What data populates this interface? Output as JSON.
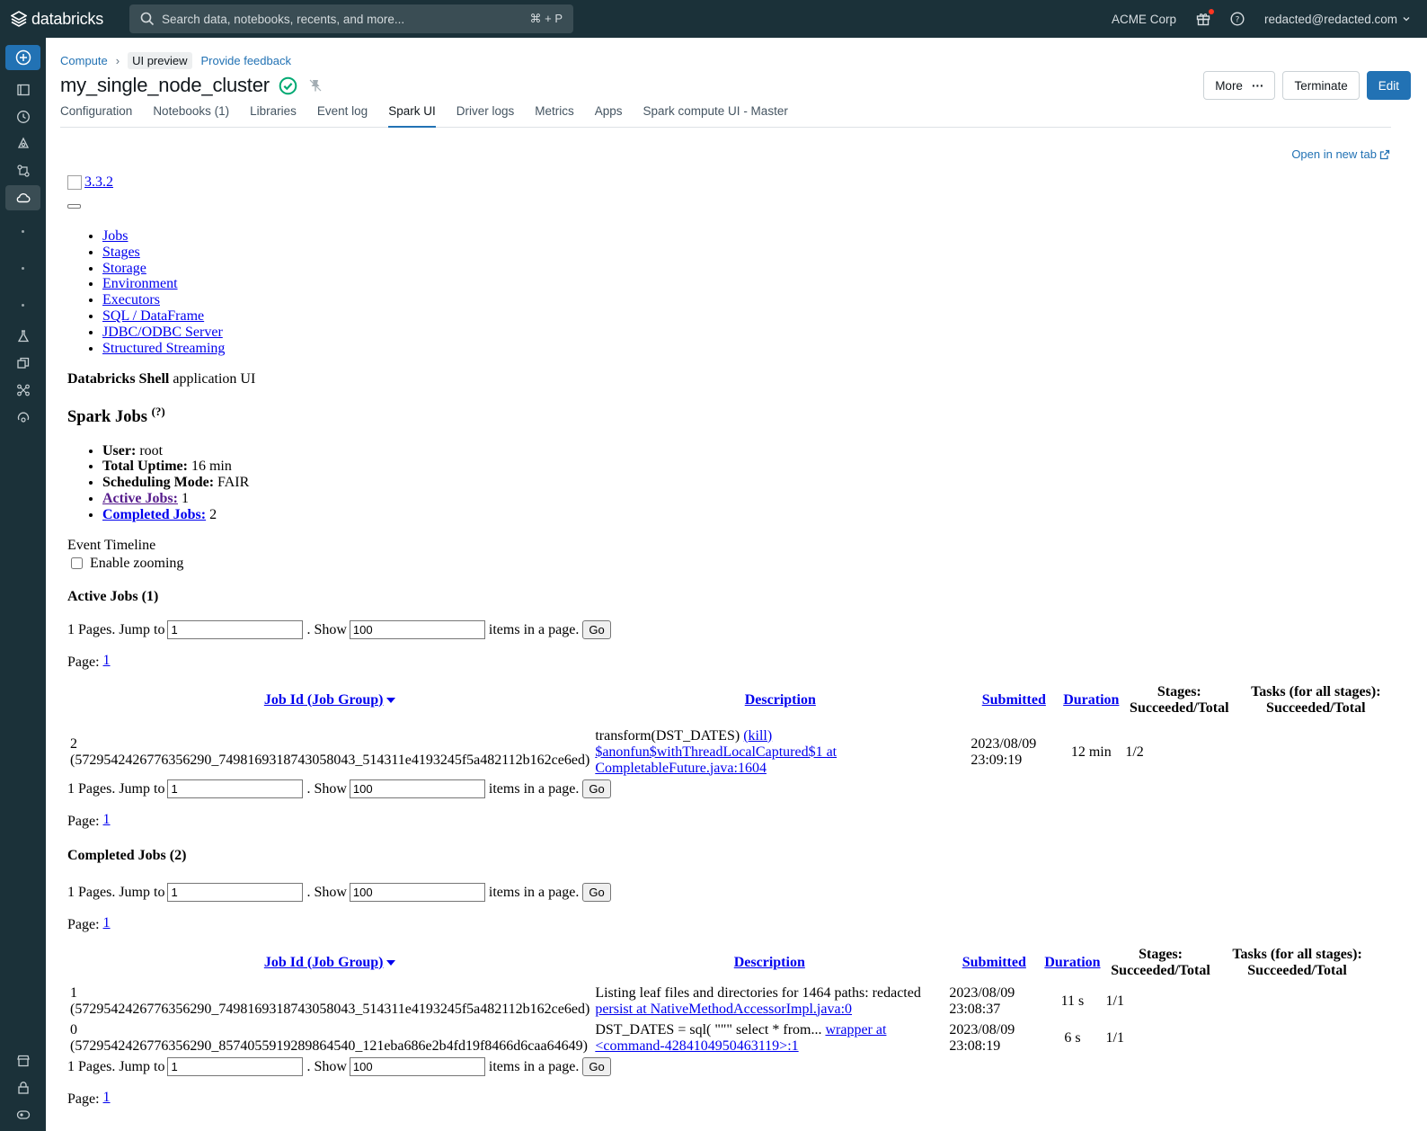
{
  "app": {
    "brand": "databricks",
    "search_placeholder": "Search data, notebooks, recents, and more...",
    "search_shortcut": "⌘ + P",
    "org": "ACME Corp",
    "user": "redacted@redacted.com",
    "colors": {
      "topbar": "#1b3139",
      "accent": "#2272b4",
      "success": "#00a972"
    }
  },
  "header": {
    "breadcrumb": "Compute",
    "preview_badge": "UI preview",
    "feedback_link": "Provide feedback",
    "cluster_name": "my_single_node_cluster",
    "more_label": "More",
    "terminate_label": "Terminate",
    "edit_label": "Edit",
    "tabs": [
      "Configuration",
      "Notebooks (1)",
      "Libraries",
      "Event log",
      "Spark UI",
      "Driver logs",
      "Metrics",
      "Apps",
      "Spark compute UI - Master"
    ],
    "active_tab": "Spark UI",
    "open_new_tab": "Open in new tab"
  },
  "spark": {
    "version": "3.3.2",
    "nav": [
      "Jobs",
      "Stages",
      "Storage",
      "Environment",
      "Executors",
      "SQL / DataFrame",
      "JDBC/ODBC Server",
      "Structured Streaming"
    ],
    "app_name": "Databricks Shell",
    "app_suffix": "application UI",
    "jobs_title": "Spark Jobs",
    "help_mark": "(?)",
    "summary": {
      "user_label": "User:",
      "user": "root",
      "uptime_label": "Total Uptime:",
      "uptime": "16 min",
      "sched_label": "Scheduling Mode:",
      "sched": "FAIR",
      "active_label": "Active Jobs:",
      "active": "1",
      "completed_label": "Completed Jobs:",
      "completed": "2"
    },
    "timeline_label": "Event Timeline",
    "zoom_label": "Enable zooming",
    "pager": {
      "pages_text": "1 Pages. Jump to",
      "jump_value": "1",
      "show_text": ". Show",
      "show_value": "100",
      "items_text": "items in a page.",
      "go_label": "Go",
      "page_label": "Page:",
      "page_link": "1"
    },
    "columns": {
      "job_id": "Job Id (Job Group)",
      "description": "Description",
      "submitted": "Submitted",
      "duration": "Duration",
      "stages_1": "Stages:",
      "stages_2": "Succeeded/Total",
      "tasks_1": "Tasks (for all stages):",
      "tasks_2": "Succeeded/Total"
    },
    "active_title": "Active Jobs (1)",
    "active_jobs": [
      {
        "id": "2",
        "group": "(5729542426776356290_7498169318743058043_514311e4193245f5a482112b162ce6ed)",
        "desc_text": "transform(DST_DATES)",
        "kill": "(kill)",
        "desc_link": "$anonfun$withThreadLocalCaptured$1 at CompletableFuture.java:1604",
        "submitted_date": "2023/08/09",
        "submitted_time": "23:09:19",
        "duration": "12 min",
        "stages": "1/2"
      }
    ],
    "completed_title": "Completed Jobs (2)",
    "completed_jobs": [
      {
        "id": "1",
        "group": "(5729542426776356290_7498169318743058043_514311e4193245f5a482112b162ce6ed)",
        "desc_text": "Listing leaf files and directories for 1464 paths: redacted",
        "desc_link": "persist at NativeMethodAccessorImpl.java:0",
        "submitted_date": "2023/08/09",
        "submitted_time": "23:08:37",
        "duration": "11 s",
        "stages": "1/1"
      },
      {
        "id": "0",
        "group": "(5729542426776356290_8574055919289864540_121eba686e2b4fd19f8466d6caa64649)",
        "desc_text": "DST_DATES = sql( \"\"\" select * from...",
        "desc_link": "wrapper at <command-4284104950463119>:1",
        "submitted_date": "2023/08/09",
        "submitted_time": "23:08:19",
        "duration": "6 s",
        "stages": "1/1"
      }
    ]
  }
}
